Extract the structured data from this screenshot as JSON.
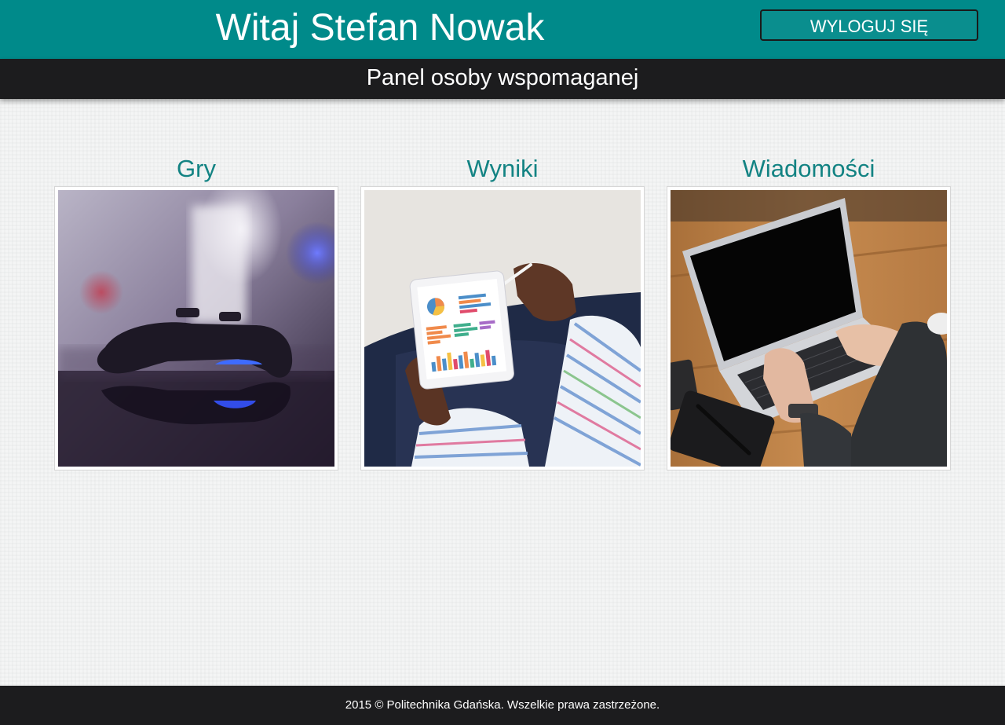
{
  "header": {
    "welcome": "Witaj Stefan Nowak",
    "logout_label": "WYLOGUJ SIĘ",
    "background_color": "#008a8a"
  },
  "subheader": {
    "title": "Panel osoby wspomaganej",
    "background_color": "#1c1c1e"
  },
  "tiles": [
    {
      "title": "Gry",
      "image": "game-controller-photo"
    },
    {
      "title": "Wyniki",
      "image": "tablet-charts-photo"
    },
    {
      "title": "Wiadomości",
      "image": "laptop-typing-photo"
    }
  ],
  "footer": {
    "text": "2015 © Politechnika Gdańska. Wszelkie prawa zastrzeżone."
  },
  "colors": {
    "accent": "#138383",
    "page_background": "#f4f5f5"
  }
}
